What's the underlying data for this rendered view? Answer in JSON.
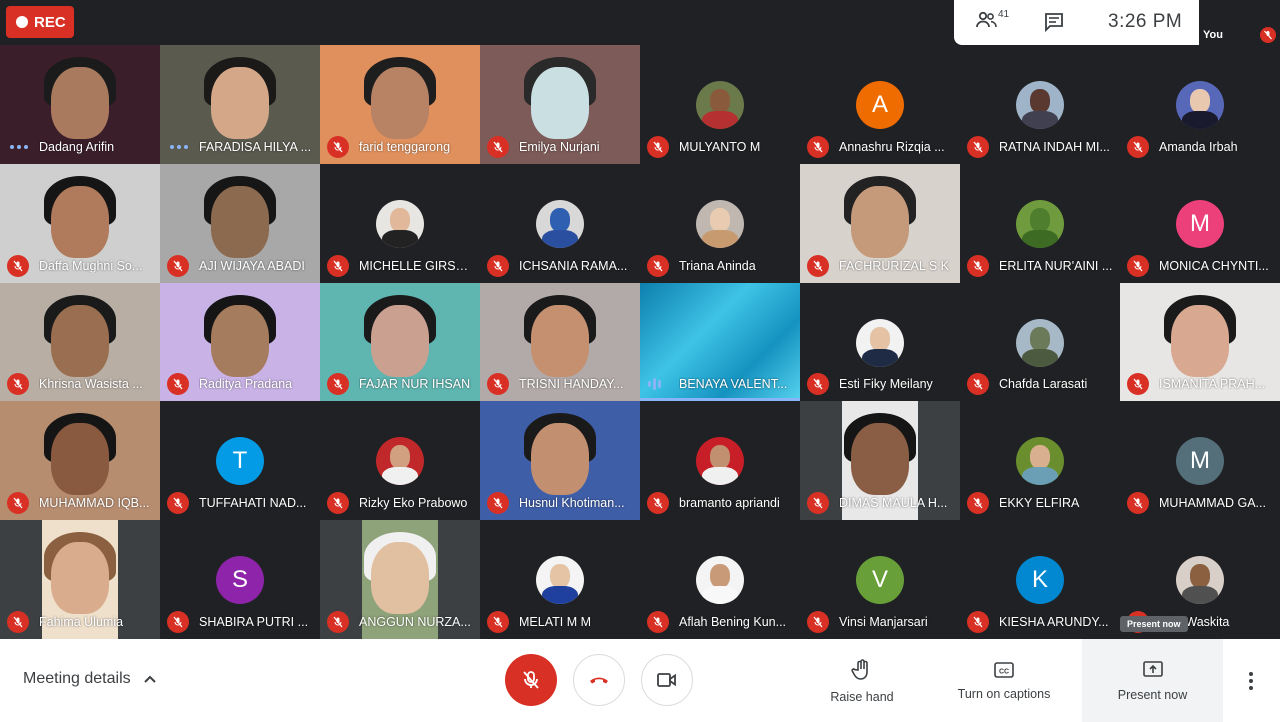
{
  "recording": {
    "label": "REC"
  },
  "top_panel": {
    "participant_count": "41",
    "time": "3:26 PM"
  },
  "self_tile": {
    "label": "You"
  },
  "participants": [
    {
      "name": "Dadang Arifin",
      "kind": "video",
      "bg": "#3a1e2a",
      "skin": "#a97a5e",
      "hair": "#1b1b1b",
      "status": "dots"
    },
    {
      "name": "FARADISA HILYA ...",
      "kind": "video",
      "bg": "#5a5a4f",
      "skin": "#d4a788",
      "hair": "#1c1a18",
      "status": "dots"
    },
    {
      "name": "farid tenggarong",
      "kind": "video",
      "bg": "#e0905c",
      "skin": "#b88365",
      "hair": "#1e1e1e",
      "status": "muted"
    },
    {
      "name": "Emilya Nurjani",
      "kind": "video",
      "bg": "#7c5b58",
      "skin": "#c9dfe2",
      "hair": "#2a2a2a",
      "status": "muted"
    },
    {
      "name": "MULYANTO M",
      "kind": "photo",
      "bg": "#202124",
      "photo_bg": "#6b7a4a",
      "photo_skin": "#8a5a3c",
      "photo_body": "#b53030",
      "status": "muted"
    },
    {
      "name": "Annashru Rizqia ...",
      "kind": "initial",
      "bg": "#202124",
      "initial": "A",
      "color": "#ef6c00",
      "status": "muted"
    },
    {
      "name": "RATNA INDAH MI...",
      "kind": "photo",
      "bg": "#202124",
      "photo_bg": "#9fb4c9",
      "photo_skin": "#5a3a30",
      "photo_body": "#404050",
      "status": "muted"
    },
    {
      "name": "Amanda Irbah",
      "kind": "photo",
      "bg": "#202124",
      "photo_bg": "#5868b8",
      "photo_skin": "#e8c9b0",
      "photo_body": "#1a1a2e",
      "status": "muted"
    },
    {
      "name": "Daffa Mughni So...",
      "kind": "video",
      "bg": "#cfcfcf",
      "skin": "#b07a5c",
      "hair": "#151515",
      "status": "muted"
    },
    {
      "name": "AJI WIJAYA ABADI",
      "kind": "video",
      "bg": "#a8a8a8",
      "skin": "#8c6a50",
      "hair": "#161616",
      "status": "muted"
    },
    {
      "name": "MICHELLE GIRSA...",
      "kind": "photo",
      "bg": "#202124",
      "photo_bg": "#e8e6e2",
      "photo_skin": "#e1b89a",
      "photo_body": "#222222",
      "status": "muted"
    },
    {
      "name": "ICHSANIA RAMA...",
      "kind": "photo",
      "bg": "#202124",
      "photo_bg": "#d8d8d8",
      "photo_skin": "#2f5fb0",
      "photo_body": "#2a4fa0",
      "status": "muted"
    },
    {
      "name": "Triana Aninda",
      "kind": "photo",
      "bg": "#202124",
      "photo_bg": "#c0b8b0",
      "photo_skin": "#e8cbb0",
      "photo_body": "#c89a70",
      "status": "muted"
    },
    {
      "name": "FACHRURIZAL S K",
      "kind": "video",
      "bg": "#d8d2cc",
      "skin": "#c49a7a",
      "hair": "#222222",
      "status": "muted"
    },
    {
      "name": "ERLITA NUR'AINI ...",
      "kind": "photo",
      "bg": "#202124",
      "photo_bg": "#6f9b3e",
      "photo_skin": "#4f7f2e",
      "photo_body": "#3d6b24",
      "status": "muted"
    },
    {
      "name": "MONICA CHYNTI...",
      "kind": "initial",
      "bg": "#202124",
      "initial": "M",
      "color": "#ec407a",
      "status": "muted"
    },
    {
      "name": "Khrisna Wasista ...",
      "kind": "video",
      "bg": "#b8aea4",
      "skin": "#9a6e50",
      "hair": "#1a1a1a",
      "status": "muted"
    },
    {
      "name": "Raditya Pradana",
      "kind": "video",
      "bg": "#c9b3e6",
      "skin": "#a67c5e",
      "hair": "#151515",
      "status": "muted"
    },
    {
      "name": "FAJAR NUR IHSAN",
      "kind": "video",
      "bg": "#5fb5b0",
      "skin": "#caa090",
      "hair": "#1a1a1a",
      "status": "muted"
    },
    {
      "name": "TRISNI HANDAY...",
      "kind": "video",
      "bg": "#b2aaa8",
      "skin": "#c49070",
      "hair": "#1a1a1a",
      "status": "muted"
    },
    {
      "name": "BENAYA VALENT...",
      "kind": "water",
      "bg": "#1e9fc8",
      "status": "speaking"
    },
    {
      "name": "Esti Fiky Meilany",
      "kind": "photo",
      "bg": "#202124",
      "photo_bg": "#f2f2f2",
      "photo_skin": "#e5c2a4",
      "photo_body": "#1f2a44",
      "status": "muted"
    },
    {
      "name": "Chafda Larasati",
      "kind": "photo",
      "bg": "#202124",
      "photo_bg": "#a7b9c6",
      "photo_skin": "#6b7a58",
      "photo_body": "#4c5a40",
      "status": "muted"
    },
    {
      "name": "ISMANITA PRAH...",
      "kind": "video",
      "bg": "#e8e6e4",
      "skin": "#d8a890",
      "hair": "#1a1a1a",
      "status": "muted"
    },
    {
      "name": "MUHAMMAD IQB...",
      "kind": "video",
      "bg": "#b78d70",
      "skin": "#8a5a40",
      "hair": "#151515",
      "status": "muted"
    },
    {
      "name": "TUFFAHATI NAD...",
      "kind": "initial",
      "bg": "#202124",
      "initial": "T",
      "color": "#039be5",
      "status": "muted"
    },
    {
      "name": "Rizky Eko Prabowo",
      "kind": "photo",
      "bg": "#202124",
      "photo_bg": "#c0282a",
      "photo_skin": "#d0a080",
      "photo_body": "#f0f0f0",
      "status": "muted"
    },
    {
      "name": "Husnul Khotiman...",
      "kind": "video",
      "bg": "#3f5ea8",
      "skin": "#c29070",
      "hair": "#1a1a1a",
      "status": "muted"
    },
    {
      "name": "bramanto apriandi",
      "kind": "photo",
      "bg": "#202124",
      "photo_bg": "#c81e28",
      "photo_skin": "#c09070",
      "photo_body": "#f0f0f0",
      "status": "muted"
    },
    {
      "name": "DIMAS MAULA H...",
      "kind": "video",
      "bg": "#e8e8e8",
      "skin": "#8a5e44",
      "hair": "#151515",
      "status": "muted",
      "narrow": true
    },
    {
      "name": "EKKY ELFIRA",
      "kind": "photo",
      "bg": "#202124",
      "photo_bg": "#6a8d2e",
      "photo_skin": "#d8b090",
      "photo_body": "#6a9fb5",
      "status": "muted"
    },
    {
      "name": "MUHAMMAD GA...",
      "kind": "initial",
      "bg": "#202124",
      "initial": "M",
      "color": "#546e7a",
      "status": "muted"
    },
    {
      "name": "Fahima Ulumia",
      "kind": "video",
      "bg": "#efe0cc",
      "skin": "#d8ac8c",
      "hair": "#8a6040",
      "status": "muted",
      "narrow": true
    },
    {
      "name": "SHABIRA PUTRI ...",
      "kind": "initial",
      "bg": "#202124",
      "initial": "S",
      "color": "#8e24aa",
      "status": "muted"
    },
    {
      "name": "ANGGUN NURZA...",
      "kind": "video",
      "bg": "#8fa37a",
      "skin": "#e0c0a0",
      "hair": "#f0f0f0",
      "status": "muted",
      "narrow": true
    },
    {
      "name": "MELATI M M",
      "kind": "photo",
      "bg": "#202124",
      "photo_bg": "#f4f4f4",
      "photo_skin": "#e4c4a4",
      "photo_body": "#2040a0",
      "status": "muted"
    },
    {
      "name": "Aflah Bening Kun...",
      "kind": "photo",
      "bg": "#202124",
      "photo_bg": "#f4f4f4",
      "photo_skin": "#c89a78",
      "photo_body": "#f8f8f8",
      "status": "muted"
    },
    {
      "name": "Vinsi Manjarsari",
      "kind": "initial",
      "bg": "#202124",
      "initial": "V",
      "color": "#689f38",
      "status": "muted"
    },
    {
      "name": "KIESHA ARUNDY...",
      "kind": "initial",
      "bg": "#202124",
      "initial": "K",
      "color": "#0288d1",
      "status": "muted"
    },
    {
      "name": "...fik Waskita",
      "kind": "photo",
      "bg": "#202124",
      "photo_bg": "#d8d0c8",
      "photo_skin": "#8a6040",
      "photo_body": "#505050",
      "status": "muted"
    }
  ],
  "tooltip": {
    "text": "Present now"
  },
  "bottom": {
    "meeting_details": "Meeting details",
    "raise_hand": "Raise hand",
    "captions": "Turn on captions",
    "present": "Present now"
  },
  "colors": {
    "accent_red": "#d93025",
    "speaking_blue": "#8ab4f8",
    "background": "#202124"
  }
}
